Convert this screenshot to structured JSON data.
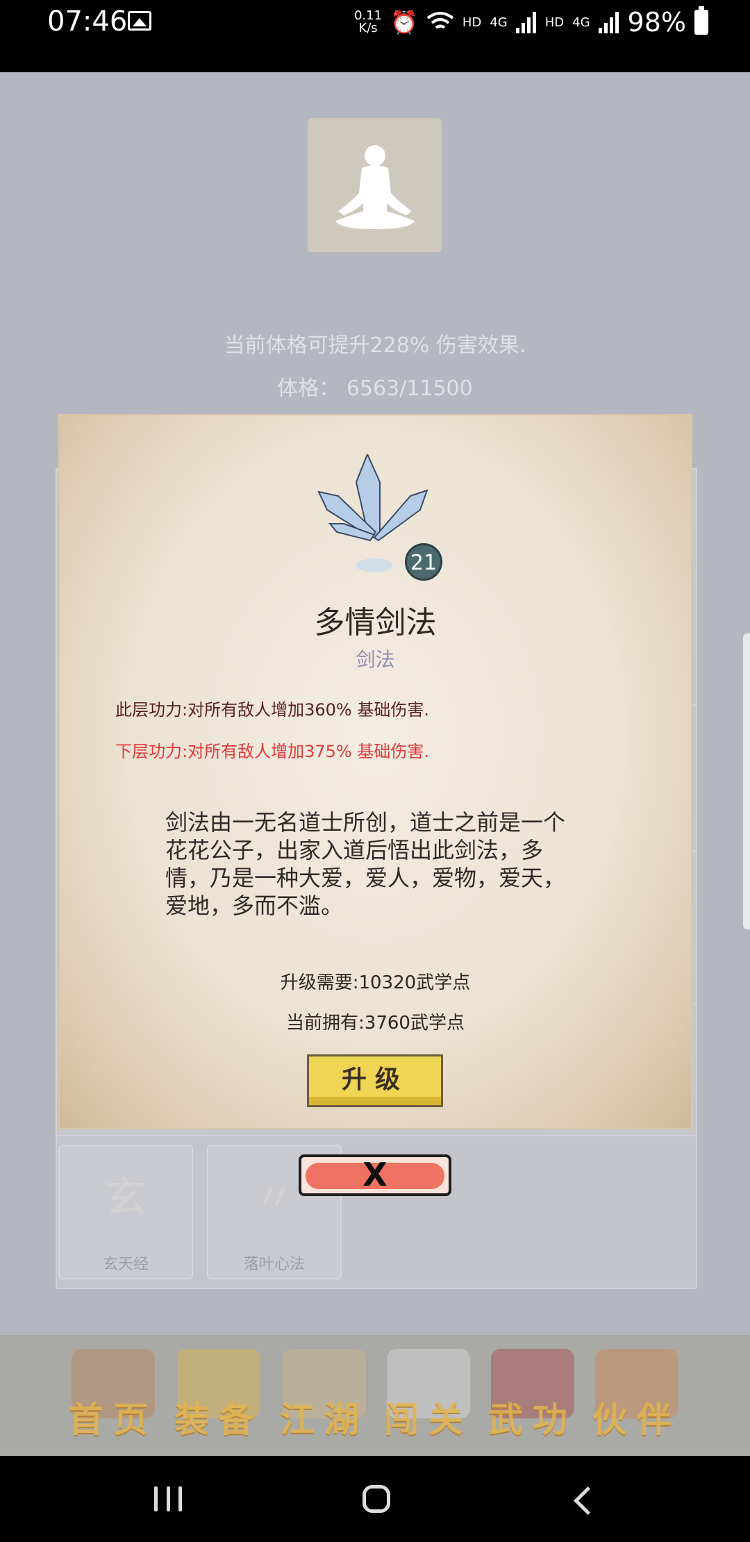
{
  "status_bar": {
    "time": "07:46",
    "net_speed_value": "0.11",
    "net_speed_unit": "K/s",
    "hd1": "HD",
    "sig1": "4G",
    "hd2": "HD",
    "sig2": "4G",
    "battery": "98%"
  },
  "attributes": {
    "bonus_text": "当前体格可提升228% 伤害效果.",
    "constitution_text": "体格：  6563/11500"
  },
  "background_tiles": [
    {
      "label": "玄天经"
    },
    {
      "label": "落叶心法"
    }
  ],
  "skill_modal": {
    "level": "21",
    "name": "多情剑法",
    "type": "剑法",
    "current_effect": "此层功力:对所有敌人增加360% 基础伤害.",
    "next_effect": "下层功力:对所有敌人增加375% 基础伤害.",
    "description": "剑法由一无名道士所创，道士之前是一个花花公子，出家入道后悟出此剑法，多情，乃是一种大爱，爱人，爱物，爱天，爱地，多而不滥。",
    "upgrade_cost": "升级需要:10320武学点",
    "current_points": "当前拥有:3760武学点",
    "upgrade_label": "升级",
    "close_label": "X"
  },
  "bottom_nav": [
    {
      "label": "首页"
    },
    {
      "label": "装备"
    },
    {
      "label": "江湖"
    },
    {
      "label": "闯关"
    },
    {
      "label": "武功"
    },
    {
      "label": "伙伴"
    }
  ]
}
